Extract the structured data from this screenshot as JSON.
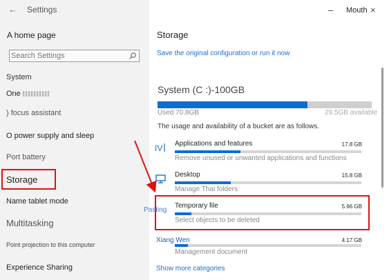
{
  "sidebar": {
    "back_icon": "back-arrow-icon",
    "title": "Settings",
    "home": "A home page",
    "search_placeholder": "Search Settings",
    "search_icon": "search-icon",
    "section": "System",
    "items": [
      "One",
      ") focus assistant",
      "O power supply and sleep",
      "Port battery",
      "Storage",
      "Name tablet mode",
      "Multitasking",
      "Point projection to this computer",
      "Experience Sharing"
    ]
  },
  "window": {
    "title": "Mouth",
    "minimize": "–",
    "close": "×"
  },
  "main": {
    "title": "Storage",
    "restore_link": "Save the original configuration or run it now",
    "drive": {
      "name": "System (C :)-100GB",
      "used": "Used 70.8GB",
      "free": "29.5GB available",
      "used_fraction": 0.7,
      "description": "The usage and availability of a bucket are as follows."
    },
    "categories": [
      {
        "name": "Applications and features",
        "size": "17.8 GB",
        "sub": "Remove unused or unwanted applications and functions",
        "fill": 0.35,
        "icon": "apps-icon"
      },
      {
        "name": "Desktop",
        "size": "15.8 GB",
        "sub": "Manage Thai folders",
        "fill": 0.3,
        "icon": "monitor-icon"
      },
      {
        "name": "Temporary file",
        "size": "5.66 GB",
        "sub": "Select objects to be deleted",
        "fill": 0.09,
        "icon": "temp-file-icon"
      },
      {
        "name": "Xiang Wen",
        "size": "4.17 GB",
        "sub": "Management document",
        "fill": 0.07,
        "icon": "document-icon"
      }
    ],
    "paste_label": "Pasting",
    "more_link": "Show more categories"
  },
  "colors": {
    "accent": "#0a6fd1",
    "highlight_border": "#dd1111",
    "link": "#1a6fcf"
  }
}
